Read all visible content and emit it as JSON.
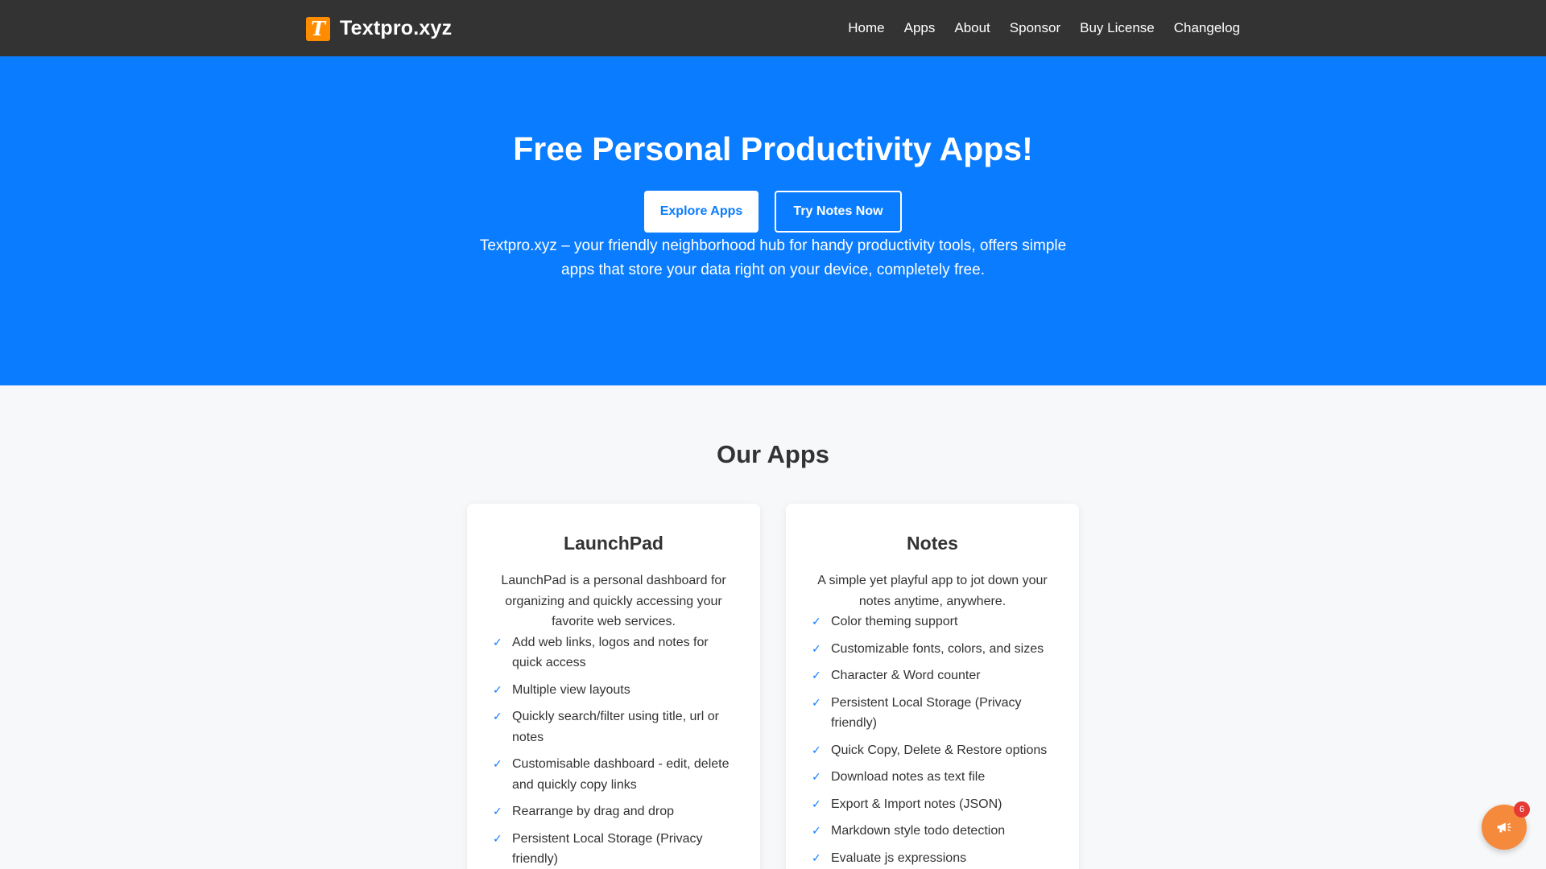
{
  "nav": {
    "brand_logo_letter": "T",
    "brand_name": "Textpro.xyz",
    "links": [
      "Home",
      "Apps",
      "About",
      "Sponsor",
      "Buy License",
      "Changelog"
    ]
  },
  "hero": {
    "title": "Free Personal Productivity Apps!",
    "primary_button": "Explore Apps",
    "secondary_button": "Try Notes Now",
    "description": "Textpro.xyz – your friendly neighborhood hub for handy productivity tools, offers simple apps that store your data right on your device, completely free."
  },
  "apps_section": {
    "title": "Our Apps",
    "cards": [
      {
        "title": "LaunchPad",
        "description": "LaunchPad is a personal dashboard for organizing and quickly accessing your favorite web services.",
        "features": [
          "Add web links, logos and notes for quick access",
          "Multiple view layouts",
          "Quickly search/filter using title, url or notes",
          "Customisable dashboard - edit, delete and quickly copy links",
          "Rearrange by drag and drop",
          "Persistent Local Storage (Privacy friendly)"
        ]
      },
      {
        "title": "Notes",
        "description": "A simple yet playful app to jot down your notes anytime, anywhere.",
        "features": [
          "Color theming support",
          "Customizable fonts, colors, and sizes",
          "Character & Word counter",
          "Persistent Local Storage (Privacy friendly)",
          "Quick Copy, Delete & Restore options",
          "Download notes as text file",
          "Export & Import notes (JSON)",
          "Markdown style todo detection",
          "Evaluate js expressions"
        ]
      }
    ]
  },
  "announcement": {
    "icon": "megaphone-icon",
    "badge_count": "6"
  },
  "colors": {
    "nav_bg": "#333333",
    "hero_bg": "#0a7cff",
    "brand_logo": "#ff8c00",
    "fab": "#f58a3c",
    "badge": "#e53935"
  }
}
